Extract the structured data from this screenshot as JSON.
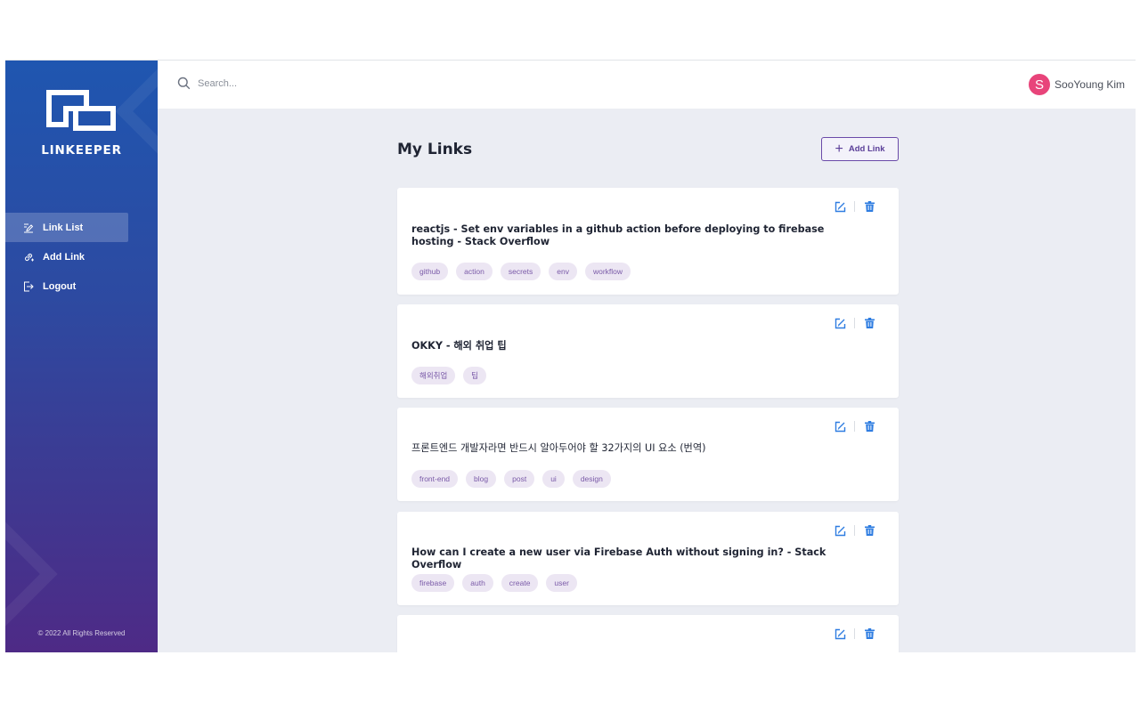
{
  "sidebar": {
    "brand": "LINKEEPER",
    "items": [
      {
        "label": "Link List",
        "icon": "edit-list-icon",
        "active": true
      },
      {
        "label": "Add Link",
        "icon": "link-add-icon",
        "active": false
      },
      {
        "label": "Logout",
        "icon": "logout-icon",
        "active": false
      }
    ],
    "copyright": "© 2022 All Rights Reserved"
  },
  "topbar": {
    "search_placeholder": "Search...",
    "user": {
      "initial": "S",
      "name": "SooYoung Kim",
      "avatar_color": "#e8447a"
    }
  },
  "main": {
    "title": "My Links",
    "add_button": "Add Link",
    "links": [
      {
        "title": "reactjs - Set env variables in a github action before deploying to firebase hosting - Stack Overflow",
        "tags": [
          "github",
          "action",
          "secrets",
          "env",
          "workflow"
        ]
      },
      {
        "title": "OKKY - 해외 취업 팁",
        "tags": [
          "해외취업",
          "팁"
        ]
      },
      {
        "title": "프론트엔드 개발자라면 반드시 알아두어야 할 32가지의 UI 요소 (번역)",
        "tags": [
          "front-end",
          "blog",
          "post",
          "ui",
          "design"
        ]
      },
      {
        "title": "How can I create a new user via Firebase Auth without signing in? - Stack Overflow",
        "tags": [
          "firebase",
          "auth",
          "create",
          "user"
        ]
      },
      {
        "title": "",
        "tags": []
      }
    ]
  },
  "colors": {
    "sidebar_top": "#1f56b0",
    "sidebar_bottom": "#4e2a86",
    "accent": "#5a3e98",
    "tag_bg": "#ece6f3",
    "action_icon": "#2f7de1",
    "background": "#ebedf3"
  }
}
